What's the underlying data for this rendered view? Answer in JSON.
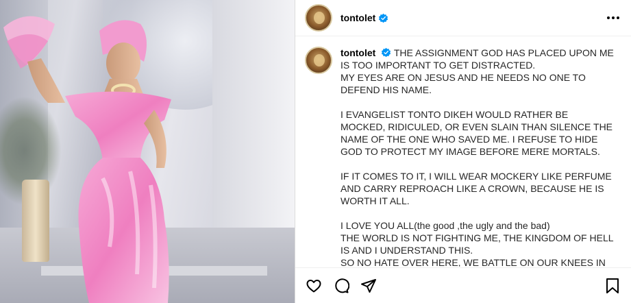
{
  "post": {
    "username": "tontolet",
    "verified": true,
    "more_icon": "more-horizontal-icon",
    "caption": {
      "paragraphs": [
        [
          "THE ASSIGNMENT GOD HAS PLACED UPON ME IS TOO IMPORTANT TO GET DISTRACTED.",
          "MY EYES ARE ON JESUS AND HE NEEDS NO ONE TO DEFEND HIS NAME."
        ],
        [
          "I EVANGELIST TONTO DIKEH WOULD RATHER BE MOCKED, RIDICULED, OR EVEN SLAIN THAN SILENCE THE NAME OF THE ONE WHO SAVED ME. I REFUSE TO HIDE GOD TO PROTECT MY IMAGE BEFORE MERE MORTALS."
        ],
        [
          "IF IT COMES TO IT, I WILL WEAR MOCKERY LIKE PERFUME AND CARRY REPROACH LIKE A CROWN, BECAUSE HE IS WORTH IT ALL."
        ],
        [
          "I LOVE YOU ALL(the good ,the ugly and the bad)",
          "THE WORLD IS NOT FIGHTING ME, THE KINGDOM OF HELL IS AND I UNDERSTAND THIS.",
          "SO NO HATE OVER HERE, WE BATTLE ON OUR KNEES IN PRAYER."
        ]
      ]
    },
    "actions": {
      "like_icon": "heart-icon",
      "comment_icon": "comment-icon",
      "share_icon": "share-icon",
      "save_icon": "bookmark-icon"
    },
    "colors": {
      "verified_blue": "#0095f6",
      "dress_pink": "#ef7fc0",
      "border": "#dbdbdb"
    }
  }
}
